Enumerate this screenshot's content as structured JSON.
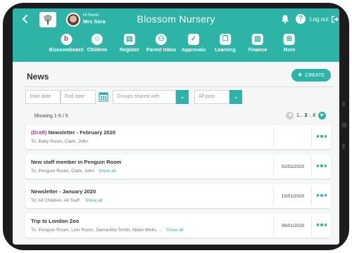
{
  "header": {
    "greeting": "Hi there!",
    "user_name": "Mrs Sara",
    "app_title": "Blossom Nursery",
    "logout_label": "Log out"
  },
  "nav": {
    "items": [
      {
        "label": "Blossomboard",
        "icon": "blossomboard-icon"
      },
      {
        "label": "Children",
        "icon": "children-icon"
      },
      {
        "label": "Register",
        "icon": "register-icon"
      },
      {
        "label": "Parent Inbox",
        "icon": "parent-inbox-icon"
      },
      {
        "label": "Approvals",
        "icon": "approvals-icon"
      },
      {
        "label": "Learning",
        "icon": "learning-icon"
      },
      {
        "label": "Finance",
        "icon": "finance-icon"
      },
      {
        "label": "More",
        "icon": "more-grid-icon"
      }
    ]
  },
  "page": {
    "title": "News",
    "create_label": "CREATE"
  },
  "filters": {
    "start_date_placeholder": "Start date",
    "end_date_placeholder": "End date",
    "groups_placeholder": "Groups shared with",
    "post_value": "All post"
  },
  "listing": {
    "showing": "Showing 1-5 / 5",
    "pager_first": "1",
    "pager_ellipsis1": "...",
    "pager_current": "2",
    "pager_ellipsis2": "...",
    "pager_last": "6"
  },
  "news": [
    {
      "draft_label": "(Draft)",
      "title": "Newsletter - February 2020",
      "to": "To: Baby Room, Clark, John",
      "show_all": "",
      "date": ""
    },
    {
      "draft_label": "",
      "title": "New staff member in Penguin Room",
      "to": "To: Penguin Room, Clark, John",
      "show_all": "Show all",
      "date": "02/02/2020"
    },
    {
      "draft_label": "",
      "title": "Newsletter - January 2020",
      "to": "To: All Children, All Staff",
      "show_all": "Show all",
      "date": "15/01/2020"
    },
    {
      "draft_label": "",
      "title": "Trip to London Zoo",
      "to": "To: Penguin Room, Lion Room, Samantha Smith, Abbie Wells, ...",
      "show_all": "Show all",
      "date": "06/01/2020"
    }
  ],
  "colors": {
    "brand": "#2db4a6",
    "draft": "#c0398b"
  }
}
